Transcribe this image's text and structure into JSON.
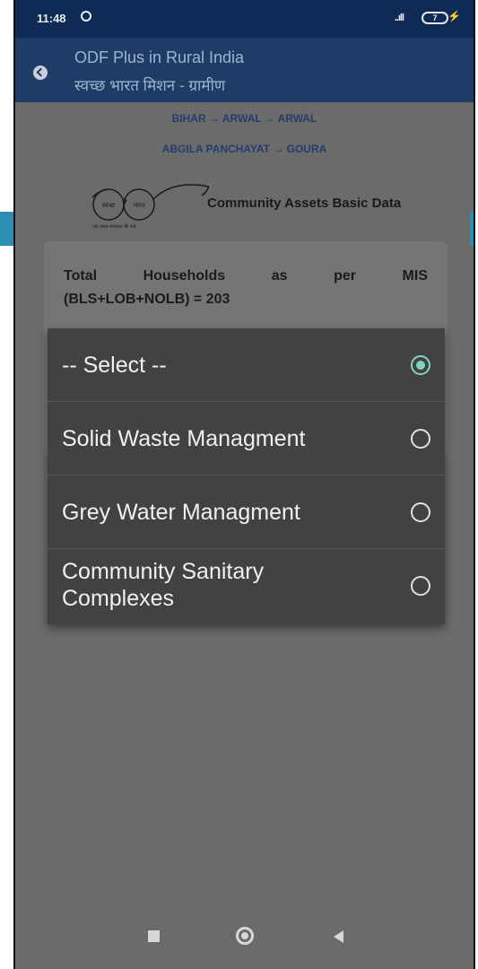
{
  "status": {
    "time": "11:48",
    "signal": "..ıll",
    "battery": "7"
  },
  "appbar": {
    "title": "ODF Plus in Rural India",
    "subtitle": "स्वच्छ भारत मिशन - ग्रामीण"
  },
  "breadcrumb": {
    "line1": "BIHAR → ARWAL → ARWAL",
    "line2": "ABGILA PANCHAYAT → GOURA"
  },
  "logo": {
    "left_word": "स्वच्छ",
    "right_word": "भारत",
    "tagline": "एक कदम स्वच्छता की ओर"
  },
  "page": {
    "heading": "Community Assets Basic Data"
  },
  "card": {
    "words": [
      "Total",
      "Households",
      "as",
      "per",
      "MIS"
    ],
    "line2": "(BLS+LOB+NOLB) =  203"
  },
  "dropdown": {
    "options": [
      {
        "label": "-- Select --",
        "selected": true
      },
      {
        "label": "Solid Waste Managment",
        "selected": false
      },
      {
        "label": "Grey Water Managment",
        "selected": false
      },
      {
        "label": "Community Sanitary Complexes",
        "selected": false
      }
    ]
  },
  "icons": {
    "back": "back-arrow-icon",
    "dnd": "do-not-disturb-icon",
    "battery": "battery-icon",
    "charging": "bolt-icon"
  }
}
